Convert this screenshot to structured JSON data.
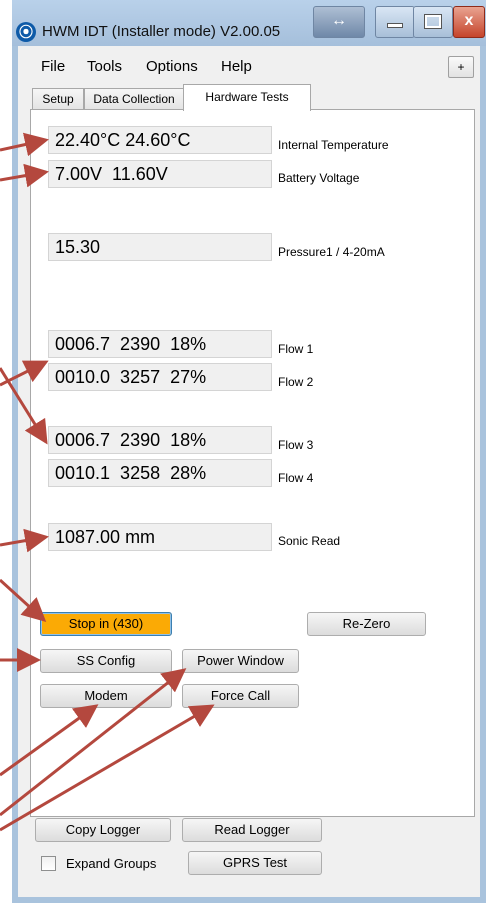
{
  "window": {
    "title": "HWM IDT (Installer mode) V2.00.05",
    "logo_icon": "hwm-logo-icon",
    "snap_glyph": "↔",
    "close_glyph": "x"
  },
  "menu": {
    "items": [
      "File",
      "Tools",
      "Options",
      "Help"
    ],
    "plus_label": "+"
  },
  "tabs": [
    {
      "label": "Setup",
      "active": false
    },
    {
      "label": "Data Collection",
      "active": false
    },
    {
      "label": "Hardware Tests",
      "active": true
    }
  ],
  "readings": {
    "internal_temperature": {
      "value": "22.40°C 24.60°C",
      "label": "Internal Temperature"
    },
    "battery_voltage": {
      "value": "7.00V  11.60V",
      "label": "Battery Voltage"
    },
    "pressure1": {
      "value": "15.30",
      "label": "Pressure1 / 4-20mA"
    },
    "flow1": {
      "value": "0006.7  2390  18%",
      "label": "Flow 1"
    },
    "flow2": {
      "value": "0010.0  3257  27%",
      "label": "Flow 2"
    },
    "flow3": {
      "value": "0006.7  2390  18%",
      "label": "Flow 3"
    },
    "flow4": {
      "value": "0010.1  3258  28%",
      "label": "Flow 4"
    },
    "sonic_read": {
      "value": "1087.00 mm",
      "label": "Sonic Read"
    }
  },
  "buttons": {
    "stop": "Stop in (430)",
    "rezero": "Re-Zero",
    "ss_config": "SS Config",
    "power_window": "Power Window",
    "modem": "Modem",
    "force_call": "Force Call",
    "copy_logger": "Copy Logger",
    "read_logger": "Read Logger",
    "gprs_test": "GPRS Test"
  },
  "expand_groups": {
    "label": "Expand Groups",
    "checked": false
  },
  "colors": {
    "stop_button_bg": "#fbaa05",
    "annotation_arrow": "#b4483e"
  }
}
